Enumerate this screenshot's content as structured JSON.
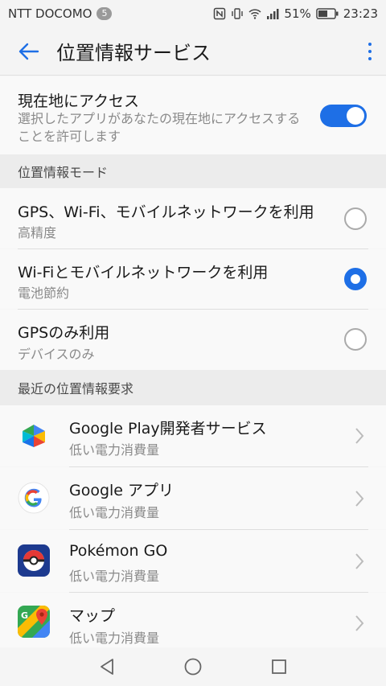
{
  "status_bar": {
    "carrier": "NTT DOCOMO",
    "notification_count": "5",
    "battery": "51%",
    "time": "23:23"
  },
  "app_bar": {
    "title": "位置情報サービス"
  },
  "access": {
    "title": "現在地にアクセス",
    "desc": "選択したアプリがあなたの現在地にアクセスすることを許可します",
    "enabled": true
  },
  "mode_section": {
    "header": "位置情報モード",
    "options": [
      {
        "title": "GPS、Wi-Fi、モバイルネットワークを利用",
        "sub": "高精度",
        "selected": false
      },
      {
        "title": "Wi-Fiとモバイルネットワークを利用",
        "sub": "電池節約",
        "selected": true
      },
      {
        "title": "GPSのみ利用",
        "sub": "デバイスのみ",
        "selected": false
      }
    ]
  },
  "recent_section": {
    "header": "最近の位置情報要求",
    "apps": [
      {
        "name": "Google Play開発者サービス",
        "usage": "低い電力消費量",
        "icon": "google-play-services-icon"
      },
      {
        "name": "Google アプリ",
        "usage": "低い電力消費量",
        "icon": "google-g-icon"
      },
      {
        "name": "Pokémon GO",
        "usage": "低い電力消費量",
        "icon": "pokeball-icon"
      },
      {
        "name": "マップ",
        "usage": "低い電力消費量",
        "icon": "google-maps-icon"
      }
    ]
  },
  "colors": {
    "accent": "#1e6fe6"
  }
}
